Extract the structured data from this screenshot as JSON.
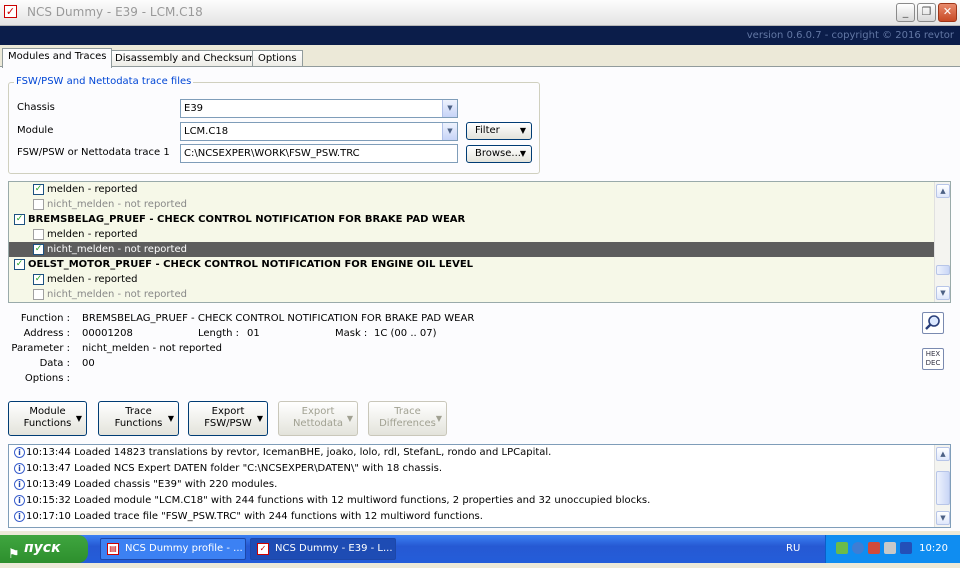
{
  "window": {
    "title": "NCS Dummy - E39 - LCM.C18",
    "version": "version 0.6.0.7 - copyright © 2016 revtor",
    "minimize": "_",
    "restore": "❐",
    "close": "✕"
  },
  "tabs": [
    "Modules and Traces",
    "Disassembly and Checksums",
    "Options"
  ],
  "trace_group": {
    "legend": "FSW/PSW and Nettodata trace files",
    "chassis_label": "Chassis",
    "chassis_value": "E39",
    "module_label": "Module",
    "module_value": "LCM.C18",
    "trace_label": "FSW/PSW or Nettodata trace 1",
    "trace_value": "C:\\NCSEXPER\\WORK\\FSW_PSW.TRC",
    "filter_label": "Filter",
    "browse_label": "Browse..."
  },
  "tree": [
    {
      "text": "melden  -  reported",
      "checked": true,
      "level": 2,
      "dim": false,
      "bold": false,
      "selected": false
    },
    {
      "text": "nicht_melden  -  not reported",
      "checked": false,
      "level": 2,
      "dim": true,
      "bold": false,
      "selected": false
    },
    {
      "text": "BREMSBELAG_PRUEF  -  CHECK CONTROL NOTIFICATION FOR BRAKE PAD WEAR",
      "checked": true,
      "level": 1,
      "dim": false,
      "bold": true,
      "selected": false
    },
    {
      "text": "melden  -  reported",
      "checked": false,
      "level": 2,
      "dim": false,
      "bold": false,
      "selected": false
    },
    {
      "text": "nicht_melden  -  not reported",
      "checked": true,
      "level": 2,
      "dim": false,
      "bold": false,
      "selected": true
    },
    {
      "text": "OELST_MOTOR_PRUEF  -  CHECK CONTROL NOTIFICATION FOR ENGINE OIL LEVEL",
      "checked": true,
      "level": 1,
      "dim": false,
      "bold": true,
      "selected": false
    },
    {
      "text": "melden  -  reported",
      "checked": true,
      "level": 2,
      "dim": false,
      "bold": false,
      "selected": false
    },
    {
      "text": "nicht_melden  -  not reported",
      "checked": false,
      "level": 2,
      "dim": true,
      "bold": false,
      "selected": false
    }
  ],
  "details": {
    "function_label": "Function :",
    "function_value": "BREMSBELAG_PRUEF  -  CHECK CONTROL NOTIFICATION FOR BRAKE PAD WEAR",
    "address_label": "Address :",
    "address_value": "00001208",
    "length_label": "Length :",
    "length_value": "01",
    "mask_label": "Mask :",
    "mask_value": "1C  (00 .. 07)",
    "parameter_label": "Parameter :",
    "parameter_value": "nicht_melden  -  not reported",
    "data_label": "Data :",
    "data_value": "00",
    "options_label": "Options :",
    "hex_dec_top": "HEX",
    "hex_dec_bottom": "DEC"
  },
  "action_buttons": [
    {
      "line1": "Module",
      "line2": "Functions",
      "enabled": true
    },
    {
      "line1": "Trace",
      "line2": "Functions",
      "enabled": true
    },
    {
      "line1": "Export",
      "line2": "FSW/PSW",
      "enabled": true
    },
    {
      "line1": "Export",
      "line2": "Nettodata",
      "enabled": false
    },
    {
      "line1": "Trace",
      "line2": "Differences",
      "enabled": false
    }
  ],
  "log": [
    "10:13:44  Loaded 14823 translations by revtor, IcemanBHE, joako, lolo, rdl, StefanL, rondo and LPCapital.",
    "10:13:47  Loaded NCS Expert DATEN folder \"C:\\NCSEXPER\\DATEN\\\" with 18 chassis.",
    "10:13:49  Loaded chassis \"E39\" with 220 modules.",
    "10:15:32  Loaded module \"LCM.C18\" with 244 functions with 12 multiword functions, 2 properties and 32 unoccupied blocks.",
    "10:17:10  Loaded trace file \"FSW_PSW.TRC\" with 244 functions with 12 multiword functions."
  ],
  "taskbar": {
    "start_label": "пуск",
    "items": [
      "NCS Dummy profile - ...",
      "NCS Dummy - E39 - L..."
    ],
    "language": "RU",
    "clock": "10:20"
  }
}
